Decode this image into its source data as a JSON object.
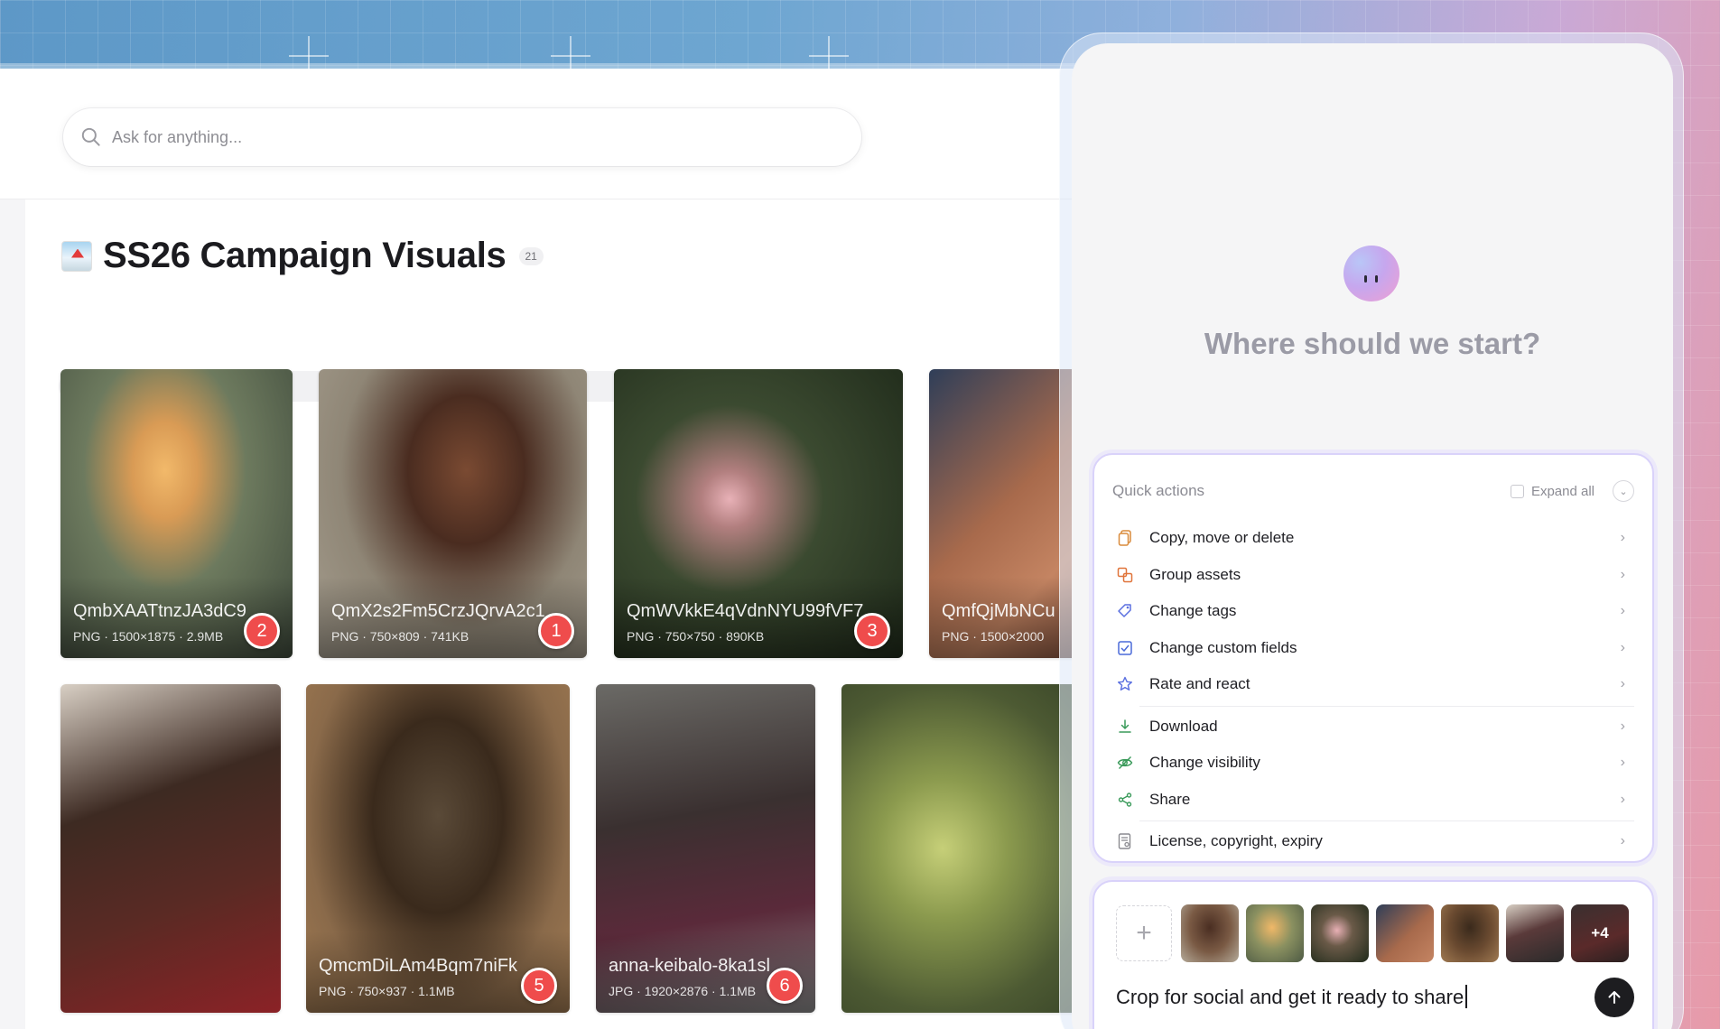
{
  "search": {
    "placeholder": "Ask for anything..."
  },
  "collection": {
    "title": "SS26 Campaign Visuals",
    "count": "21"
  },
  "assets": [
    {
      "name": "QmbXAATtnzJA3dC9",
      "type": "PNG",
      "dims": "1500×1875",
      "size": "2.9MB",
      "badge": "2"
    },
    {
      "name": "QmX2s2Fm5CrzJQrvA2c1",
      "type": "PNG",
      "dims": "750×809",
      "size": "741KB",
      "badge": "1"
    },
    {
      "name": "QmWVkkE4qVdnNYU99fVF7",
      "type": "PNG",
      "dims": "750×750",
      "size": "890KB",
      "badge": "3"
    },
    {
      "name": "QmfQjMbNCu",
      "type": "PNG",
      "dims": "1500×2000",
      "size": "",
      "badge": ""
    },
    {
      "name": "",
      "type": "",
      "dims": "",
      "size": "",
      "badge": ""
    },
    {
      "name": "QmcmDiLAm4Bqm7niFk",
      "type": "PNG",
      "dims": "750×937",
      "size": "1.1MB",
      "badge": "5"
    },
    {
      "name": "anna-keibalo-8ka1sl",
      "type": "JPG",
      "dims": "1920×2876",
      "size": "1.1MB",
      "badge": "6"
    },
    {
      "name": "",
      "type": "",
      "dims": "",
      "size": "",
      "badge": ""
    }
  ],
  "assistant": {
    "prompt_title": "Where should we start?",
    "quick_actions": {
      "title": "Quick actions",
      "expand_all": "Expand all",
      "items": [
        {
          "label": "Copy, move or delete",
          "icon": "copy-icon"
        },
        {
          "label": "Group assets",
          "icon": "group-icon"
        },
        {
          "label": "Change tags",
          "icon": "tag-icon"
        },
        {
          "label": "Change custom fields",
          "icon": "checkbox-icon"
        },
        {
          "label": "Rate and react",
          "icon": "star-icon"
        },
        {
          "label": "Download",
          "icon": "download-icon"
        },
        {
          "label": "Change visibility",
          "icon": "eye-off-icon"
        },
        {
          "label": "Share",
          "icon": "share-icon"
        },
        {
          "label": "License, copyright, expiry",
          "icon": "license-icon"
        }
      ]
    },
    "composer": {
      "text": "Crop for social and get it ready to share",
      "more_count": "+4"
    }
  },
  "colors": {
    "badge": "#ef4c4c",
    "accent_border": "#d9d2fa",
    "title": "#1b1b1f"
  }
}
